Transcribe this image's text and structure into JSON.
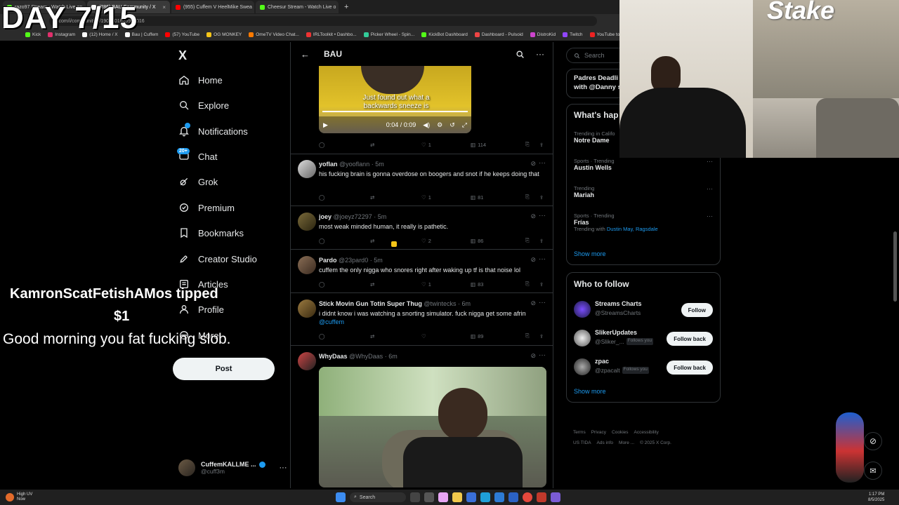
{
  "browser": {
    "tabs": [
      {
        "label": "razo97 Stream - Watch Live on",
        "color": "#53fc18",
        "active": false
      },
      {
        "label": "(286) BAU Community / X",
        "color": "#ffffff",
        "active": true
      },
      {
        "label": "(955) Cuffem V HeelMike Swea",
        "color": "#ff0000",
        "active": false
      },
      {
        "label": "Cheesur Stream - Watch Live o",
        "color": "#53fc18",
        "active": false
      }
    ],
    "address": "x.com/i/communities/1908701625962016",
    "bookmarks": [
      "Kick",
      "Instagram",
      "(12) Home / X",
      "Bau | Cuffem",
      "(57) YouTube",
      "OG MONKEY",
      "OmeTV Video Chat...",
      "IRLToolkit • Dashbo...",
      "Picker Wheel - Spin...",
      "KickBot Dashboard",
      "Dashboard - Pulsoid",
      "DistroKid",
      "Twitch",
      "YouTube to WAV D..."
    ]
  },
  "overlay": {
    "day_label": "DAY 7/15",
    "tip_name": "KamronScatFetishAMos tipped",
    "tip_amount": "$1",
    "tip_message": "Good morning you fat fucking slob."
  },
  "sidebar": {
    "logo": "X",
    "items": [
      {
        "label": "Home",
        "icon": "home-icon"
      },
      {
        "label": "Explore",
        "icon": "search-icon"
      },
      {
        "label": "Notifications",
        "icon": "bell-icon"
      },
      {
        "label": "Chat",
        "icon": "chat-icon",
        "badge": "20+"
      },
      {
        "label": "Grok",
        "icon": "grok-icon"
      },
      {
        "label": "Premium",
        "icon": "premium-icon"
      },
      {
        "label": "Bookmarks",
        "icon": "bookmark-icon"
      },
      {
        "label": "Creator Studio",
        "icon": "rocket-icon"
      },
      {
        "label": "Articles",
        "icon": "article-icon"
      },
      {
        "label": "Profile",
        "icon": "person-icon"
      },
      {
        "label": "More",
        "icon": "more-icon"
      }
    ],
    "post_label": "Post",
    "account": {
      "name": "CuffemKALLME ...",
      "handle": "@cuff3m"
    }
  },
  "feed": {
    "title": "BAU",
    "video": {
      "caption": "Just found out what a backwards sneeze is",
      "time": "0:04 / 0:09",
      "views": "114",
      "likes": "1"
    },
    "tweets": [
      {
        "name": "yoflan",
        "handle": "@yooflann",
        "time": "5m",
        "text": "his fucking brain is gonna overdose on boogers and snot if he keeps doing that",
        "likes": "1",
        "views": "81"
      },
      {
        "name": "joey",
        "handle": "@joeyz72297",
        "time": "5m",
        "text": "most weak minded human, it really is pathetic.",
        "likes": "2",
        "views": "86"
      },
      {
        "name": "Pardo",
        "handle": "@23pard0",
        "time": "5m",
        "text": "cuffem the only nigga who snores right after waking up tf is that noise lol",
        "likes": "1",
        "views": "83"
      },
      {
        "name": "Stick Movin Gun Totin Super Thug",
        "handle": "@twintecks",
        "time": "6m",
        "text": "i didnt know i was watching a snorting simulator. fuck nigga get some afrin",
        "mention": "@cuffem",
        "likes": "",
        "views": "89"
      },
      {
        "name": "WhyDaas",
        "handle": "@WhyDaas",
        "time": "6m"
      }
    ]
  },
  "right": {
    "search_placeholder": "Search",
    "promo_line1": "Padres Deadli",
    "promo_line2": "with @Danny s",
    "whats_happening": "What's hap",
    "trends": [
      {
        "meta": "Trending in Califo",
        "name": "Notre Dame"
      },
      {
        "meta": "Sports · Trending",
        "name": "Austin Wells"
      },
      {
        "meta": "Trending",
        "name": "Mariah"
      },
      {
        "meta": "Sports · Trending",
        "name": "Frías",
        "with_label": "Trending with",
        "with_links": "Dustin May, Ragsdale"
      }
    ],
    "show_more": "Show more",
    "who_to_follow": "Who to follow",
    "follows": [
      {
        "name": "Streams Charts",
        "handle": "@StreamsCharts",
        "button": "Follow",
        "follows_you": ""
      },
      {
        "name": "SlikerUpdates",
        "handle": "@Sliker_...",
        "button": "Follow back",
        "follows_you": "Follows you"
      },
      {
        "name": "zpac",
        "handle": "@zpacalt",
        "button": "Follow back",
        "follows_you": "Follows you"
      }
    ],
    "show_more_2": "Show more",
    "footer1": [
      "Terms",
      "Privacy",
      "Cookies",
      "Accessibility"
    ],
    "footer2": [
      "US TIDA",
      "Ads info",
      "More ...",
      "© 2025 X Corp."
    ]
  },
  "taskbar": {
    "weather_line1": "High UV",
    "weather_line2": "Now",
    "search": "Search",
    "time": "1:17 PM",
    "date": "8/5/2025"
  },
  "webcam": {
    "brand": "Stake"
  }
}
